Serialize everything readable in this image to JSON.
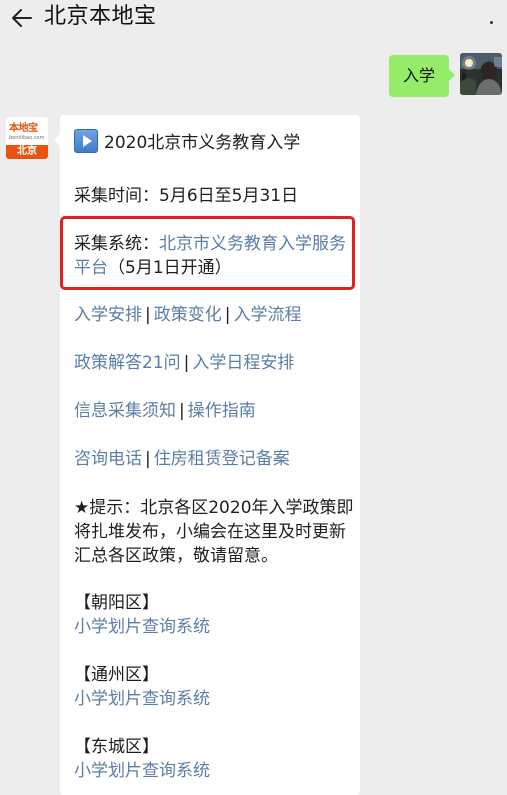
{
  "header": {
    "title": "北京本地宝",
    "back_icon": "arrow-left-icon",
    "more_icon": "more-dots-icon"
  },
  "outgoing": {
    "text": "入学",
    "bubble_color": "#95ec69"
  },
  "incoming": {
    "avatar": {
      "logo_text": "本地宝",
      "logo_url": "bendibao.com",
      "city": "北京",
      "brand_color": "#e8540e"
    },
    "title": "2020北京市义务教育入学",
    "collect_time": "采集时间：5月6日至5月31日",
    "collect_system_label": "采集系统：",
    "collect_system_link": "北京市义务教育入学服务平台",
    "collect_system_note": "（5月1日开通）",
    "links_row1": [
      "入学安排",
      "政策变化",
      "入学流程"
    ],
    "links_row2": [
      "政策解答21问",
      "入学日程安排"
    ],
    "links_row3": [
      "信息采集须知",
      "操作指南"
    ],
    "links_row4": [
      "咨询电话",
      "住房租赁登记备案"
    ],
    "separator": "|",
    "tip": "★提示：北京各区2020年入学政策即将扎堆发布，小编会在这里及时更新汇总各区政策，敬请留意。",
    "districts": [
      {
        "name": "【朝阳区】",
        "link": "小学划片查询系统"
      },
      {
        "name": "【通州区】",
        "link": "小学划片查询系统"
      },
      {
        "name": "【东城区】",
        "link": "小学划片查询系统"
      }
    ],
    "link_color": "#5b7ea6",
    "highlight_color": "#e32020"
  }
}
